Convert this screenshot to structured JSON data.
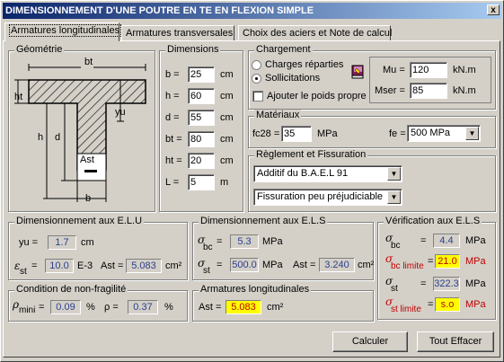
{
  "window": {
    "title": "DIMENSIONNEMENT D'UNE POUTRE EN TE EN FLEXION SIMPLE",
    "close": "x"
  },
  "tabs": [
    "Armatures longitudinales",
    "Armatures transversales",
    "Choix des aciers et Note de calcul"
  ],
  "geometrie": {
    "caption": "Géométrie",
    "labels": {
      "bt": "bt",
      "ht": "ht",
      "h": "h",
      "d": "d",
      "yu": "yu",
      "ast": "Ast",
      "b": "b"
    }
  },
  "dimensions": {
    "caption": "Dimensions",
    "rows": [
      {
        "label": "b =",
        "value": "25",
        "unit": "cm"
      },
      {
        "label": "h =",
        "value": "60",
        "unit": "cm"
      },
      {
        "label": "d =",
        "value": "55",
        "unit": "cm"
      },
      {
        "label": "bt =",
        "value": "80",
        "unit": "cm"
      },
      {
        "label": "ht =",
        "value": "20",
        "unit": "cm"
      },
      {
        "label": "L =",
        "value": "5",
        "unit": "m"
      }
    ]
  },
  "chargement": {
    "caption": "Chargement",
    "opt1": "Charges réparties",
    "opt2": "Sollicitations",
    "poids": "Ajouter le poids propre",
    "mu_label": "Mu =",
    "mu_value": "120",
    "mu_unit": "kN.m",
    "mser_label": "Mser =",
    "mser_value": "85",
    "mser_unit": "kN.m"
  },
  "materiaux": {
    "caption": "Matériaux",
    "fc28_label": "fc28 =",
    "fc28_value": "35",
    "fc28_unit": "MPa",
    "fe_label": "fe =",
    "fe_value": "500 MPa"
  },
  "reglement": {
    "caption": "Règlement et Fissuration",
    "reglement_value": "Additif du B.A.E.L 91",
    "fissuration_value": "Fissuration peu préjudiciable"
  },
  "elu": {
    "caption": "Dimensionnement aux E.L.U",
    "yu_label": "yu =",
    "yu_value": "1.7",
    "yu_unit": "cm",
    "est_sym": "ε",
    "est_sub": "st",
    "est_eq": "=",
    "est_value": "10.0",
    "est_unit": "E-3",
    "ast_label": "Ast =",
    "ast_value": "5.083",
    "ast_unit": "cm²"
  },
  "els": {
    "caption": "Dimensionnement aux E.L.S",
    "sigma": "σ",
    "bc": "bc",
    "st": "st",
    "eq": "=",
    "sbc_value": "5.3",
    "sbc_unit": "MPa",
    "sst_value": "500.0",
    "sst_unit": "MPa",
    "ast_label": "Ast =",
    "ast_value": "3.240",
    "ast_unit": "cm²"
  },
  "verification": {
    "caption": "Vérification aux E.L.S",
    "sigma": "σ",
    "eq": "=",
    "bc": "bc",
    "bc_limite": "bc limite",
    "st": "st",
    "st_limite": "st limite",
    "sbc_value": "4.4",
    "sbc_lim_value": "21.0",
    "sst_value": "322.3",
    "sst_lim_value": "s.o",
    "unit": "MPa"
  },
  "fragilite": {
    "caption": "Condition de non-fragilité",
    "rho": "ρ",
    "mini": "mini",
    "eq": "=",
    "rho_mini_value": "0.09",
    "pct": "%",
    "rho_eq": "ρ =",
    "rho_value": "0.37"
  },
  "armlong": {
    "caption": "Armatures longitudinales",
    "ast_label": "Ast =",
    "ast_value": "5.083",
    "ast_unit": "cm²"
  },
  "buttons": {
    "calculer": "Calculer",
    "effacer": "Tout Effacer"
  }
}
